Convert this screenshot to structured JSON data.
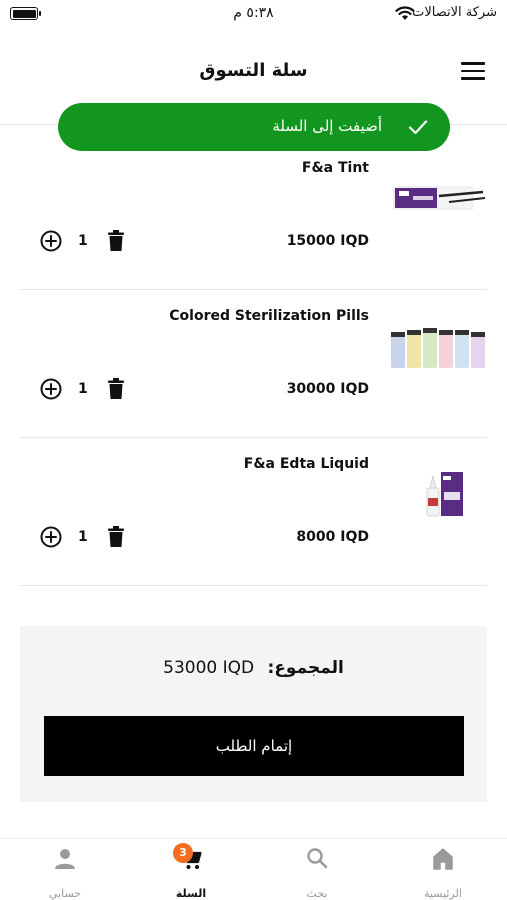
{
  "status_bar": {
    "time": "٥:٣٨ م",
    "carrier": "شركة الاتصالات"
  },
  "header": {
    "title": "سلة التسوق",
    "menu_icon": "hamburger-menu-icon"
  },
  "toast": {
    "message": "أضيفت إلى السلة",
    "icon": "check-icon",
    "color": "#13961f"
  },
  "cart": {
    "items": [
      {
        "name": "F&a Tint",
        "price": "15000 IQD",
        "quantity": "1"
      },
      {
        "name": "Colored Sterilization Pills",
        "price": "30000 IQD",
        "quantity": "1"
      },
      {
        "name": "F&a Edta Liquid",
        "price": "8000 IQD",
        "quantity": "1"
      }
    ]
  },
  "summary": {
    "total_label": "المجموع:",
    "total_value": "53000 IQD",
    "checkout_label": "إتمام الطلب"
  },
  "bottom_nav": {
    "items": [
      {
        "label": "الرئيسية",
        "icon": "home-icon"
      },
      {
        "label": "بحث",
        "icon": "search-icon"
      },
      {
        "label": "السلة",
        "icon": "cart-icon",
        "badge": "3",
        "active": true
      },
      {
        "label": "حسابي",
        "icon": "user-icon"
      }
    ],
    "badge_color": "#f26d21"
  }
}
